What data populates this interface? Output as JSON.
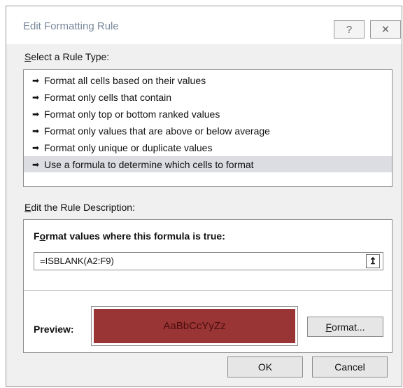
{
  "dialog": {
    "title": "Edit Formatting Rule",
    "help_glyph": "?",
    "close_glyph": "✕"
  },
  "rule_type": {
    "label_accel": "S",
    "label_rest": "elect a Rule Type:",
    "arrow_glyph": "➡",
    "items": [
      {
        "label": "Format all cells based on their values"
      },
      {
        "label": "Format only cells that contain"
      },
      {
        "label": "Format only top or bottom ranked values"
      },
      {
        "label": "Format only values that are above or below average"
      },
      {
        "label": "Format only unique or duplicate values"
      },
      {
        "label": "Use a formula to determine which cells to format"
      }
    ],
    "selected_index": 5
  },
  "description": {
    "label_accel": "E",
    "label_rest": "dit the Rule Description:",
    "formula_label_start": "F",
    "formula_label_accel": "o",
    "formula_label_rest": "rmat values where this formula is true:",
    "formula_value": "=ISBLANK(A2:F9)",
    "collapse_glyph": "↥",
    "preview_label": "Preview:",
    "preview_text": "AaBbCcYyZz",
    "preview_fill_color": "#9a3535",
    "preview_text_color": "#4a0d0d",
    "format_accel": "F",
    "format_rest": "ormat..."
  },
  "footer": {
    "ok_label": "OK",
    "cancel_label": "Cancel"
  }
}
